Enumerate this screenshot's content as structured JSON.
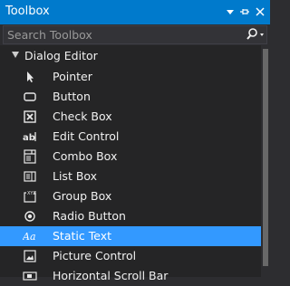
{
  "window": {
    "title": "Toolbox",
    "controls": {
      "dropdown_icon": "chevron-down-icon",
      "pin_icon": "pin-icon",
      "close_icon": "close-icon"
    }
  },
  "search": {
    "placeholder": "Search Toolbox",
    "value": "",
    "icon": "search-icon"
  },
  "group": {
    "label": "Dialog Editor",
    "expanded": true
  },
  "items": [
    {
      "label": "Pointer",
      "icon": "pointer-icon"
    },
    {
      "label": "Button",
      "icon": "button-icon"
    },
    {
      "label": "Check Box",
      "icon": "checkbox-icon"
    },
    {
      "label": "Edit Control",
      "icon": "edit-control-icon"
    },
    {
      "label": "Combo Box",
      "icon": "combo-box-icon"
    },
    {
      "label": "List Box",
      "icon": "list-box-icon"
    },
    {
      "label": "Group Box",
      "icon": "group-box-icon"
    },
    {
      "label": "Radio Button",
      "icon": "radio-button-icon"
    },
    {
      "label": "Static Text",
      "icon": "static-text-icon"
    },
    {
      "label": "Picture Control",
      "icon": "picture-control-icon"
    },
    {
      "label": "Horizontal Scroll Bar",
      "icon": "horizontal-scroll-bar-icon"
    }
  ],
  "selected_item": "Static Text",
  "colors": {
    "titlebar": "#007acc",
    "background": "#252526",
    "selection": "#3399ff",
    "text": "#f1f1f1"
  }
}
